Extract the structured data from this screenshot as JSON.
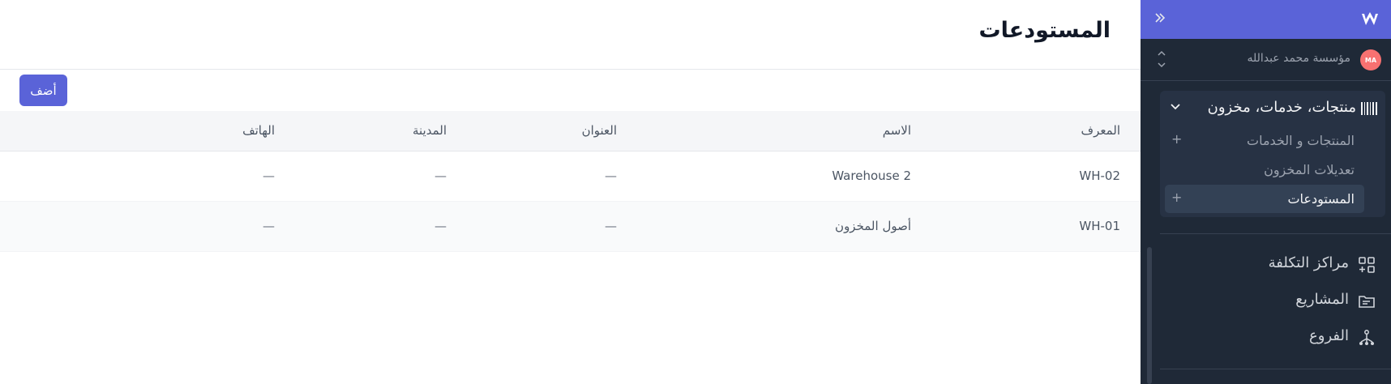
{
  "page": {
    "title": "المستودعات",
    "add_label": "أضف"
  },
  "table": {
    "columns": [
      "المعرف",
      "الاسم",
      "العنوان",
      "المدينة",
      "الهاتف"
    ],
    "rows": [
      {
        "id": "WH-02",
        "name": "Warehouse 2",
        "address": "—",
        "city": "—",
        "phone": "—"
      },
      {
        "id": "WH-01",
        "name": "أصول المخزون",
        "address": "—",
        "city": "—",
        "phone": "—"
      }
    ]
  },
  "sidebar": {
    "collapse_icon": "double-chevron-right-icon",
    "logo_icon": "w-logo-icon",
    "org": {
      "initials": "MA",
      "name": "مؤسسة محمد عبدالله"
    },
    "group": {
      "title": "منتجات، خدمات، مخزون",
      "icon": "barcode-icon",
      "items": [
        {
          "label": "المنتجات و الخدمات",
          "plus": "+"
        },
        {
          "label": "تعديلات المخزون",
          "plus": ""
        },
        {
          "label": "المستودعات",
          "plus": "+"
        }
      ]
    },
    "nav": [
      {
        "label": "مراكز التكلفة",
        "icon": "grid-plus-icon"
      },
      {
        "label": "المشاريع",
        "icon": "folder-icon"
      },
      {
        "label": "الفروع",
        "icon": "branches-icon"
      }
    ]
  },
  "colors": {
    "accent": "#5a63d8",
    "sidebar_bg": "#1f2937",
    "avatar": "#f87171"
  }
}
